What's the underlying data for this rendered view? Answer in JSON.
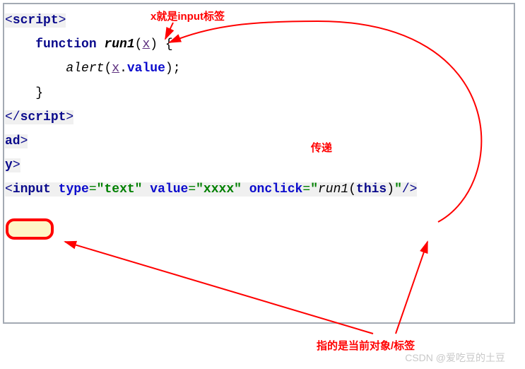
{
  "code": {
    "line1_open": "<",
    "line1_tag": "script",
    "line1_close": ">",
    "line2_kw": "function",
    "line2_fn": "run1",
    "line2_lp": "(",
    "line2_param": "x",
    "line2_rp": ")",
    "line2_brace": " {",
    "line3_call": "alert",
    "line3_lp": "(",
    "line3_arg": "x",
    "line3_dot": ".",
    "line3_attr": "value",
    "line3_rp": ")",
    "line3_semi": ";",
    "line4_brace": "}",
    "line5_open": "</",
    "line5_tag": "script",
    "line5_close": ">",
    "line6": "ad",
    "line6_close": ">",
    "line7": "y",
    "line7_close": ">",
    "line8_open": "<",
    "line8_tag": "input",
    "line8_sp": " ",
    "line8_attr1": "type",
    "line8_eq": "=",
    "line8_val1": "\"text\"",
    "line8_attr2": "value",
    "line8_val2": "\"xxxx\"",
    "line8_attr3": "onclick",
    "line8_val3_open": "\"",
    "line8_val3_fn": "run1",
    "line8_val3_lp": "(",
    "line8_val3_this": "this",
    "line8_val3_rp": ")",
    "line8_val3_close": "\"",
    "line8_selfclose": "/>"
  },
  "annotations": {
    "top": "x就是input标签",
    "mid": "传递",
    "bottom": "指的是当前对象/标签"
  },
  "watermark": "CSDN @爱吃豆的土豆"
}
